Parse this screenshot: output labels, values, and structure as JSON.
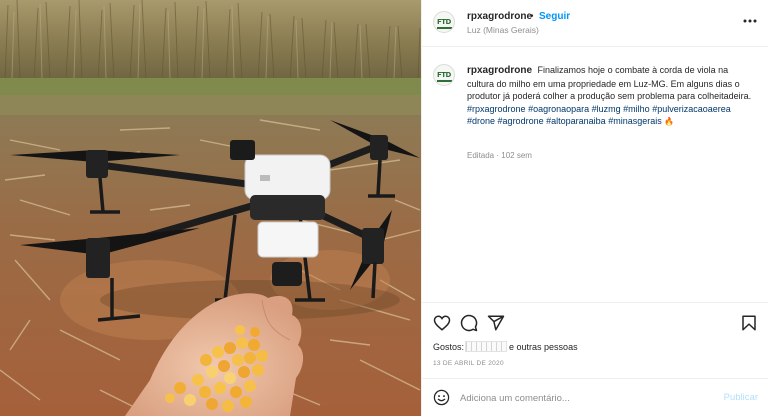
{
  "post": {
    "username": "rpxagrodrone",
    "separator": "•",
    "follow_label": "Seguir",
    "location": "Luz (Minas Gerais)",
    "avatar_text": "FTD"
  },
  "caption": {
    "username": "rpxagrodrone",
    "text": "Finalizamos hoje o combate à corda de viola na cultura do milho em uma propriedade em Luz-MG. Em alguns dias o produtor já poderá colher a produção sem problema para colheitadeira.",
    "hashtags": [
      "#rpxagrodrone",
      "#oagronaopara",
      "#luzmg",
      "#milho",
      "#pulverizacaoaerea",
      "#drone",
      "#agrodrone",
      "#altoparanaiba",
      "#minasgerais"
    ],
    "emoji": "🔥",
    "edited": "Editada · 102 sem"
  },
  "engagement": {
    "likes_prefix": "Gostos",
    "likes_suffix": "e outras pessoas",
    "date": "13 DE ABRIL DE 2020"
  },
  "comment": {
    "placeholder": "Adiciona um comentário...",
    "publish_label": "Publicar"
  },
  "icons": {
    "like": "heart-icon",
    "comment": "comment-icon",
    "share": "share-icon",
    "save": "bookmark-icon",
    "more": "more-options-icon",
    "emoji": "emoji-icon"
  },
  "colors": {
    "link_blue": "#0095f6",
    "hashtag": "#00376b",
    "muted": "#8e8e8e",
    "publish_disabled": "#b2dffc"
  }
}
